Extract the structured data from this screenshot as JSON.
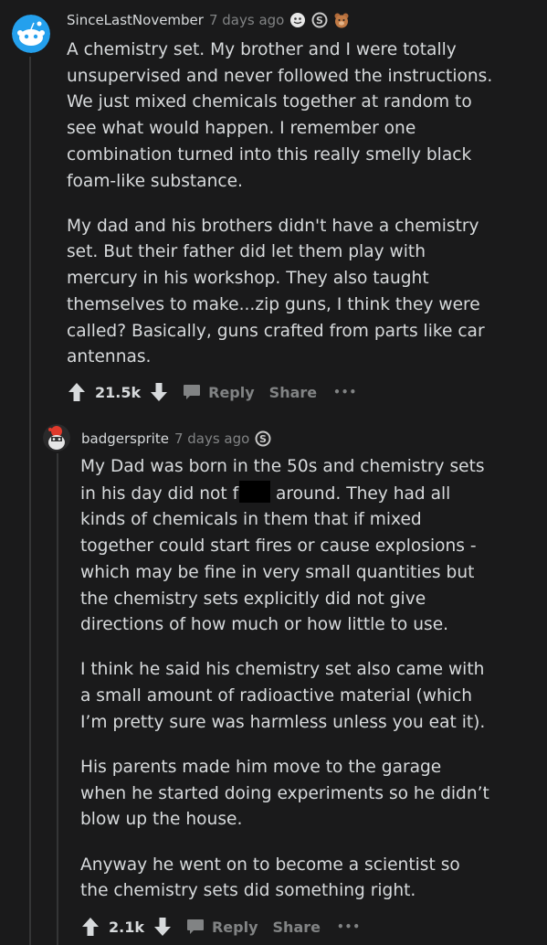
{
  "comment1": {
    "author": "SinceLastNovember",
    "time": "7 days ago",
    "awards": [
      "smiley-award-icon",
      "silver-award-icon",
      "bear-award-icon"
    ],
    "paragraphs": [
      "A chemistry set. My brother and I were totally unsupervised and never followed the instructions. We just mixed chemicals together at random to see what would happen. I remember one combination turned into this really smelly black foam-like substance.",
      "My dad and his brothers didn't have a chemistry set. But their father did let them play with mercury in his workshop. They also taught themselves to make...zip guns, I think they were called? Basically, guns crafted from parts like car antennas."
    ],
    "score": "21.5k",
    "reply_label": "Reply",
    "share_label": "Share",
    "more_label": "•••"
  },
  "comment2": {
    "author": "badgersprite",
    "time": "7 days ago",
    "awards": [
      "silver-award-icon"
    ],
    "p1_before": "My Dad was born in the 50s and chemistry sets in his day did not f",
    "p1_after": " around. They had all kinds of chemicals in them that if mixed together could start fires or cause explosions - which may be fine in very small quantities but the chemistry sets explicitly did not give directions of how much or how little to use.",
    "paragraphs": [
      "I think he said his chemistry set also came with a small amount of radioactive material (which I’m pretty sure was harmless unless you eat it).",
      "His parents made him move to the garage when he started doing experiments so he didn’t blow up the house.",
      "Anyway he went on to become a scientist so the chemistry sets did something right."
    ],
    "score": "2.1k",
    "reply_label": "Reply",
    "share_label": "Share",
    "more_label": "•••"
  },
  "colors": {
    "background": "#1a1a1b",
    "text": "#d7dadc",
    "meta": "#818384",
    "thread_line": "#343536"
  }
}
